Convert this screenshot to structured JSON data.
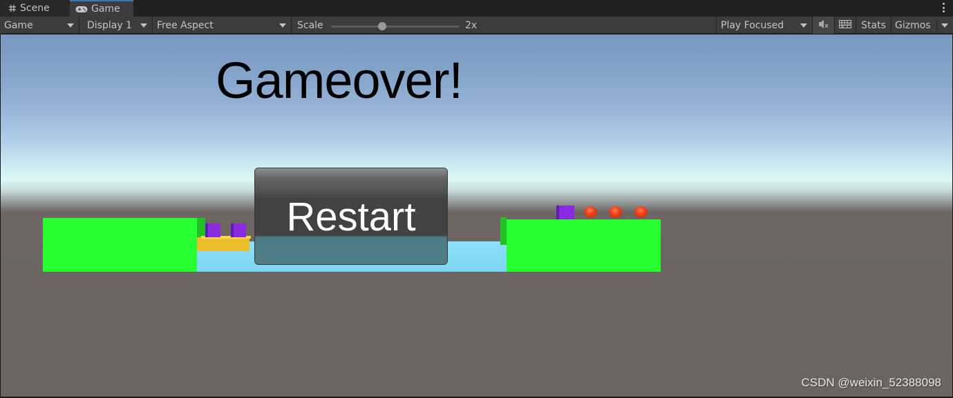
{
  "tabs": [
    {
      "label": "Scene",
      "icon": "grid-hash-icon",
      "active": false
    },
    {
      "label": "Game",
      "icon": "gamepad-icon",
      "active": true
    }
  ],
  "toolbar": {
    "game_view_select": "Game",
    "display_select": "Display 1",
    "aspect_select": "Free Aspect",
    "scale_label": "Scale",
    "scale_value": "2x",
    "scale_fraction": 0.4,
    "play_mode_select": "Play Focused",
    "mute_audio_icon": "mute-audio-icon",
    "keyboard_icon": "keyboard-icon",
    "stats_label": "Stats",
    "gizmos_label": "Gizmos"
  },
  "game": {
    "title": "Gameover!",
    "restart_label": "Restart",
    "colors": {
      "platform": "#28ff30",
      "water": "#8ee2fb",
      "boat": "#ecbe2b",
      "cube": "#8a2be2",
      "ball": "#e8401a",
      "ground": "#6b6461"
    },
    "left_bank_cubes": 2,
    "right_bank_cubes": 1,
    "right_bank_balls": 3
  },
  "watermark": "CSDN @weixin_52388098"
}
